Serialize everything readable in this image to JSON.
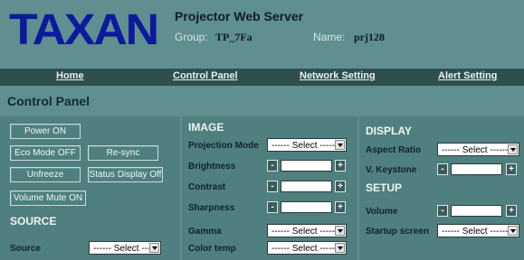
{
  "header": {
    "logo": "TAXAN",
    "title": "Projector Web Server",
    "group_label": "Group:",
    "group_value": "TP_7Fa",
    "name_label": "Name:",
    "name_value": "prj128"
  },
  "nav": {
    "items": [
      "Home",
      "Control Panel",
      "Network Setting",
      "Alert Setting"
    ]
  },
  "page_title": "Control Panel",
  "left": {
    "buttons": {
      "power_on": "Power ON",
      "eco_mode_off": "Eco Mode OFF",
      "resync": "Re-sync",
      "unfreeze": "Unfreeze",
      "status_display_off": "Status Display Off",
      "volume_mute_on": "Volume Mute ON"
    },
    "source_title": "SOURCE",
    "source_label": "Source",
    "source_select": "------ Select ------"
  },
  "image": {
    "title": "IMAGE",
    "projection_mode_label": "Projection Mode",
    "projection_mode_select": "------ Select ------",
    "brightness_label": "Brightness",
    "contrast_label": "Contrast",
    "sharpness_label": "Sharpness",
    "gamma_label": "Gamma",
    "gamma_select": "------ Select ------",
    "color_temp_label": "Color temp",
    "color_temp_select": "------ Select ------",
    "minus": "-",
    "plus": "+"
  },
  "display": {
    "title": "DISPLAY",
    "aspect_ratio_label": "Aspect Ratio",
    "aspect_ratio_select": "------ Select ------",
    "v_keystone_label": "V. Keystone"
  },
  "setup": {
    "title": "SETUP",
    "volume_label": "Volume",
    "startup_screen_label": "Startup screen",
    "startup_screen_select": "------ Select ------"
  },
  "colors": {
    "background": "#5f8f8e",
    "panel": "#4f7f7e",
    "nav_bar": "#2f4f4f",
    "logo": "#0b1a9e"
  }
}
